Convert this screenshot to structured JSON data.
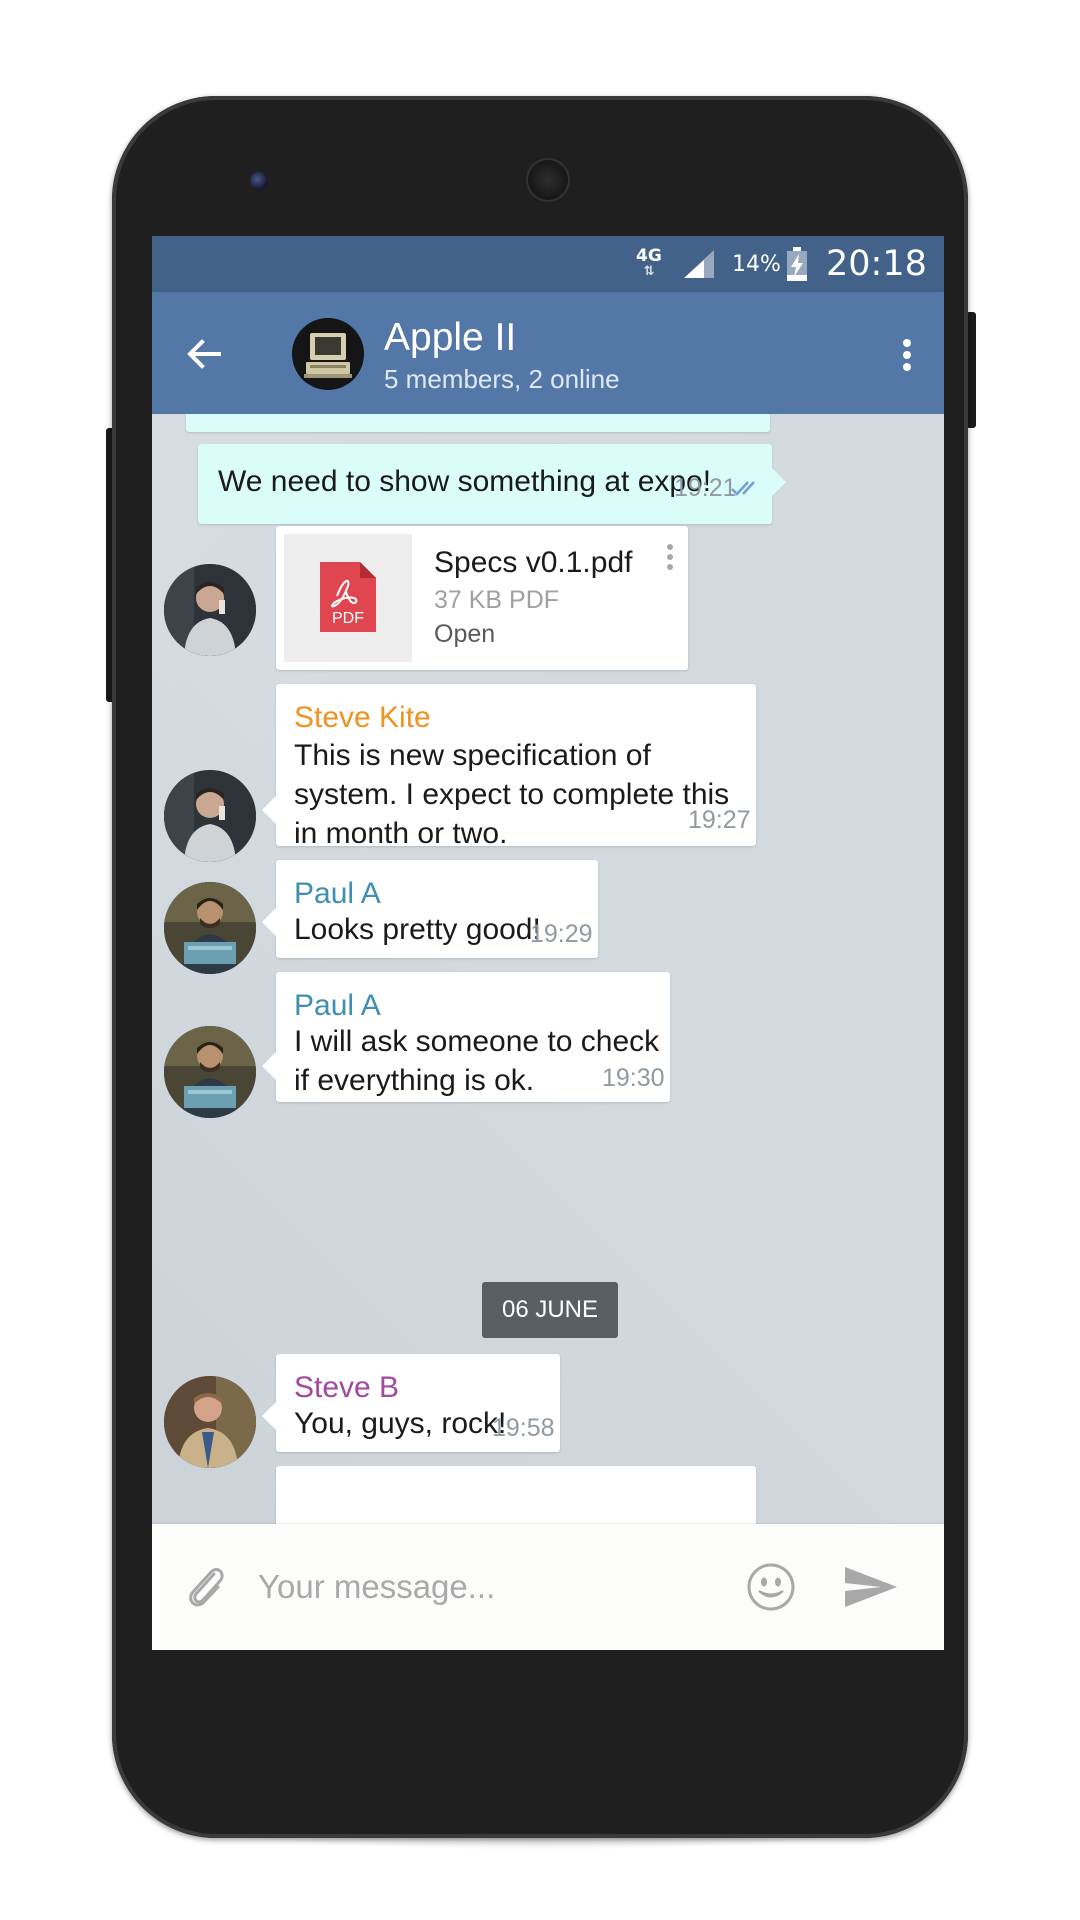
{
  "status_bar": {
    "network": "4G",
    "network_arrows": "⇅",
    "battery_percent": "14%",
    "time": "20:18"
  },
  "header": {
    "back_icon": "arrow-left-icon",
    "title": "Apple II",
    "subtitle": "5 members, 2 online",
    "menu_icon": "more-vertical-icon"
  },
  "colors": {
    "status_bar": "#43628a",
    "app_bar": "#5378a8",
    "outgoing_bubble": "#dbfdfa",
    "incoming_bubble": "#ffffff",
    "chat_background": "#d2dae0",
    "sender_steve_kite": "#f0921e",
    "sender_paul_a": "#3e8fb0",
    "sender_steve_b": "#a2499f",
    "read_check": "#6e9fd6"
  },
  "messages": [
    {
      "type": "outgoing",
      "text": "We need to show something at expo!",
      "time": "19:21",
      "status": "read"
    },
    {
      "type": "file",
      "file_name": "Specs v0.1.pdf",
      "file_meta": "37 KB PDF",
      "action": "Open",
      "file_badge": "PDF"
    },
    {
      "type": "incoming",
      "sender": "Steve Kite",
      "text": "This is new specification of system. I expect to complete this in month or two.",
      "time": "19:27"
    },
    {
      "type": "incoming",
      "sender": "Paul A",
      "text": "Looks pretty good!",
      "time": "19:29"
    },
    {
      "type": "incoming",
      "sender": "Paul A",
      "text": "I will ask someone to check if everything is ok.",
      "time": "19:30"
    },
    {
      "type": "date",
      "label": "06 JUNE"
    },
    {
      "type": "incoming",
      "sender": "Steve B",
      "text": "You, guys, rock!",
      "time": "19:58"
    }
  ],
  "composer": {
    "placeholder": "Your message...",
    "attach_icon": "paperclip-icon",
    "emoji_icon": "smiley-icon",
    "send_icon": "send-icon"
  }
}
